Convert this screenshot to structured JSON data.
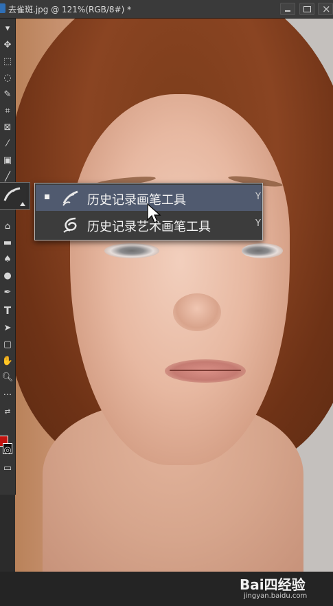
{
  "window": {
    "title": "去雀斑.jpg @ 121%(RGB/8#) *"
  },
  "flyout_menu": {
    "items": [
      {
        "label": "历史记录画笔工具",
        "shortcut": "Y",
        "selected": true,
        "icon": "history-brush-icon"
      },
      {
        "label": "历史记录艺术画笔工具",
        "shortcut": "Y",
        "selected": false,
        "icon": "art-history-brush-icon"
      }
    ]
  },
  "toolbar": {
    "tools": [
      "move-icon",
      "marquee-icon",
      "lasso-icon",
      "quick-selection-icon",
      "crop-icon",
      "frame-icon",
      "eyedropper-icon",
      "healing-brush-icon",
      "brush-icon",
      "history-brush-icon",
      "clone-stamp-icon",
      "eraser-icon",
      "gradient-icon",
      "blur-icon",
      "dodge-icon",
      "pen-icon",
      "type-icon",
      "path-selection-icon",
      "rectangle-icon",
      "hand-icon",
      "zoom-icon",
      "more-icon"
    ],
    "foreground_color": "#c0120e",
    "background_color": "#111111"
  },
  "watermark": {
    "logo": "Bai四经验",
    "site": "jingyan.baidu.com"
  }
}
